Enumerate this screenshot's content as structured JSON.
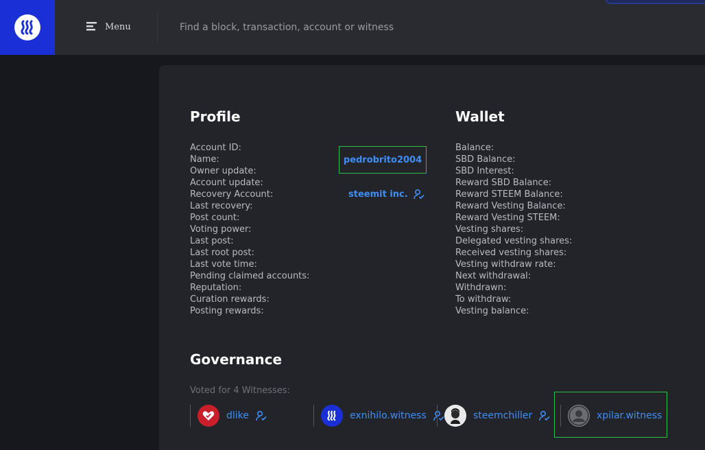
{
  "header": {
    "menu_label": "Menu",
    "search_placeholder": "Find a block, transaction, account or witness"
  },
  "colors": {
    "brand_blue": "#1a2fd6",
    "link_blue": "#3f8ef5",
    "highlight_green": "#27c24c",
    "card_bg": "#23242a"
  },
  "profile": {
    "title": "Profile",
    "labels": [
      "Account ID:",
      "Name:",
      "Owner update:",
      "Account update:",
      "Recovery Account:",
      "Last recovery:",
      "Post count:",
      "Voting power:",
      "Last post:",
      "Last root post:",
      "Last vote time:",
      "Pending claimed accounts:",
      "Reputation:",
      "Curation rewards:",
      "Posting rewards:"
    ],
    "name_value": "pedrobrito2004",
    "recovery_value": "steemit inc."
  },
  "wallet": {
    "title": "Wallet",
    "labels": [
      "Balance:",
      "SBD Balance:",
      "SBD Interest:",
      "Reward SBD Balance:",
      "Reward STEEM Balance:",
      "Reward Vesting Balance:",
      "Reward Vesting STEEM:",
      "Vesting shares:",
      "Delegated vesting shares:",
      "Received vesting shares:",
      "Vesting withdraw rate:",
      "Next withdrawal:",
      "Withdrawn:",
      "To withdraw:",
      "Vesting balance:"
    ]
  },
  "governance": {
    "title": "Governance",
    "voted_label": "Voted for 4 Witnesses:",
    "witnesses": [
      {
        "name": "dlike",
        "icon": "dlike-heart-icon"
      },
      {
        "name": "exnihilo.witness",
        "icon": "steem-logo-icon"
      },
      {
        "name": "steemchiller",
        "icon": "avatar-photo-icon"
      },
      {
        "name": "xpilar.witness",
        "icon": "default-user-icon"
      }
    ]
  }
}
